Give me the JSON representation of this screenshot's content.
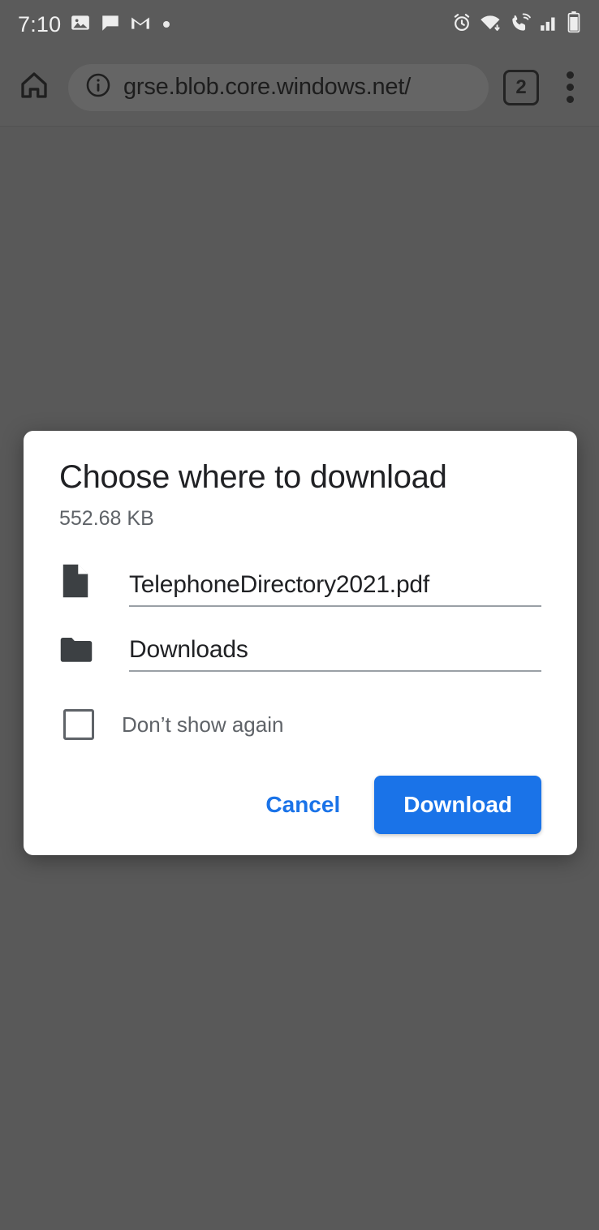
{
  "status_bar": {
    "clock": "7:10",
    "left_icons": [
      "photo-icon",
      "message-icon",
      "gmail-icon",
      "dot-indicator-icon"
    ],
    "right_icons": [
      "alarm-icon",
      "wifi-icon",
      "vowifi-call-icon",
      "signal-bars-icon",
      "battery-icon"
    ]
  },
  "toolbar": {
    "home_icon": "home-icon",
    "security_icon": "info-circle-icon",
    "url": "grse.blob.core.windows.net/",
    "tab_count": "2",
    "menu_icon": "overflow-menu-icon"
  },
  "dialog": {
    "title": "Choose where to download",
    "subtitle": "552.68 KB",
    "file_field": {
      "icon": "document-icon",
      "value": "TelephoneDirectory2021.pdf"
    },
    "folder_field": {
      "icon": "folder-icon",
      "value": "Downloads"
    },
    "checkbox": {
      "label": "Don’t show again",
      "checked": false
    },
    "cancel_label": "Cancel",
    "download_label": "Download"
  },
  "colors": {
    "accent_blue": "#1a73e8",
    "scrim": "#595959",
    "toolbar_bg": "#5b5b5b",
    "dialog_bg": "#ffffff",
    "icon_dark": "#3c4043",
    "text_secondary": "#5f6368"
  }
}
